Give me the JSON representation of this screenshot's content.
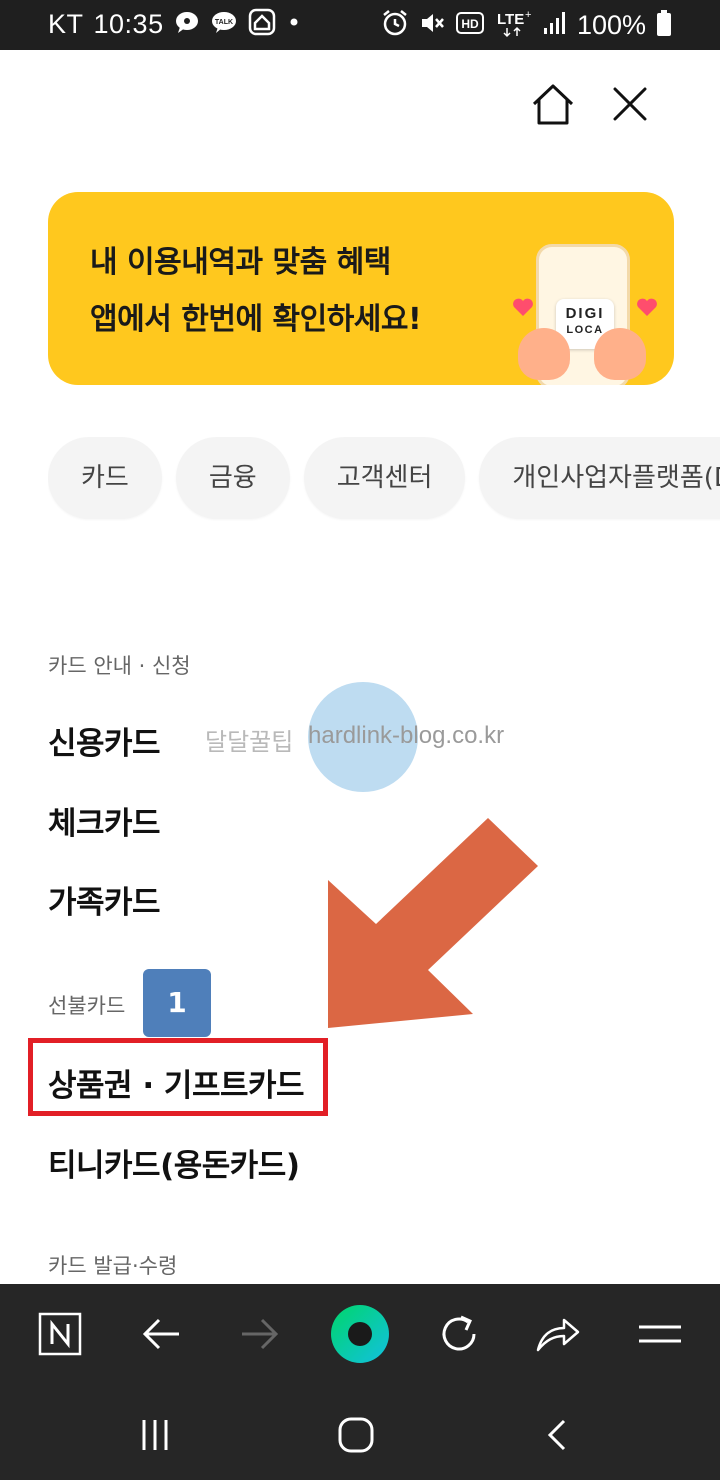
{
  "status_bar": {
    "carrier": "KT",
    "time": "10:35",
    "battery_percent": "100%",
    "icons_left": [
      "chat-bubble-icon",
      "kakaotalk-icon",
      "home-app-icon",
      "dot-icon"
    ],
    "icons_right": [
      "alarm-icon",
      "mute-icon",
      "hd-icon",
      "lte-icon",
      "signal-icon",
      "battery-icon"
    ]
  },
  "header": {
    "icons": [
      "home-icon",
      "close-icon"
    ]
  },
  "banner": {
    "line1": "내 이용내역과 맞춤 혜택",
    "line2": "앱에서 한번에 확인하세요!",
    "logo_top": "DIGI",
    "logo_bottom": "LOCA",
    "background": "#ffc81e"
  },
  "chips": [
    {
      "label": "카드"
    },
    {
      "label": "금융"
    },
    {
      "label": "고객센터"
    },
    {
      "label": "개인사업자플랫폼(D"
    }
  ],
  "menu": {
    "section_card_guide": "카드 안내 · 신청",
    "credit_card": "신용카드",
    "check_card": "체크카드",
    "family_card": "가족카드",
    "section_prepaid": "선불카드",
    "gift_card": "상품권 · 기프트카드",
    "tini_card": "티니카드(용돈카드)",
    "section_issue": "카드 발급·수령"
  },
  "annotation": {
    "badge_number": "1",
    "badge_color": "#4f7fba",
    "highlight_color": "#e21f26",
    "arrow_color": "#db6744"
  },
  "watermark": {
    "text_ko": "달달꿀팁",
    "text_en": "hardlink-blog.co.kr"
  },
  "browser_toolbar": {
    "buttons": [
      "naver-n-icon",
      "back-arrow-icon",
      "forward-arrow-icon",
      "green-dot-icon",
      "refresh-icon",
      "share-icon",
      "menu-icon"
    ]
  },
  "system_nav": {
    "buttons": [
      "recent-apps-icon",
      "home-circle-icon",
      "back-chevron-icon"
    ]
  }
}
